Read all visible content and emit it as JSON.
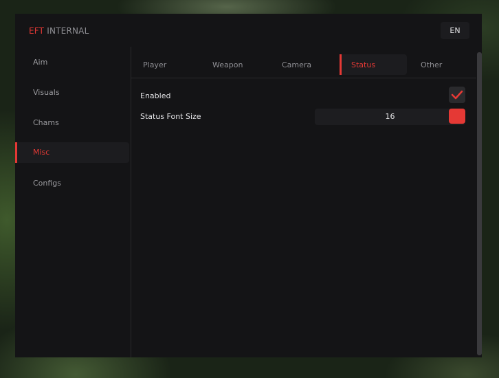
{
  "app": {
    "title_accent": "EFT",
    "title_rest": "INTERNAL",
    "language": "EN"
  },
  "sidebar": {
    "items": [
      {
        "label": "Aim",
        "active": false
      },
      {
        "label": "Visuals",
        "active": false
      },
      {
        "label": "Chams",
        "active": false
      },
      {
        "label": "Misc",
        "active": true
      },
      {
        "label": "Configs",
        "active": false
      }
    ]
  },
  "tabs": [
    {
      "label": "Player",
      "active": false
    },
    {
      "label": "Weapon",
      "active": false
    },
    {
      "label": "Camera",
      "active": false
    },
    {
      "label": "Status",
      "active": true
    },
    {
      "label": "Other",
      "active": false
    }
  ],
  "settings": {
    "enabled": {
      "label": "Enabled",
      "checked": true
    },
    "font_size": {
      "label": "Status Font Size",
      "value": "16"
    }
  },
  "colors": {
    "accent": "#e53935",
    "panel": "#141416",
    "control": "#1c1c1f"
  },
  "icons": {
    "checkmark": "check-icon"
  }
}
